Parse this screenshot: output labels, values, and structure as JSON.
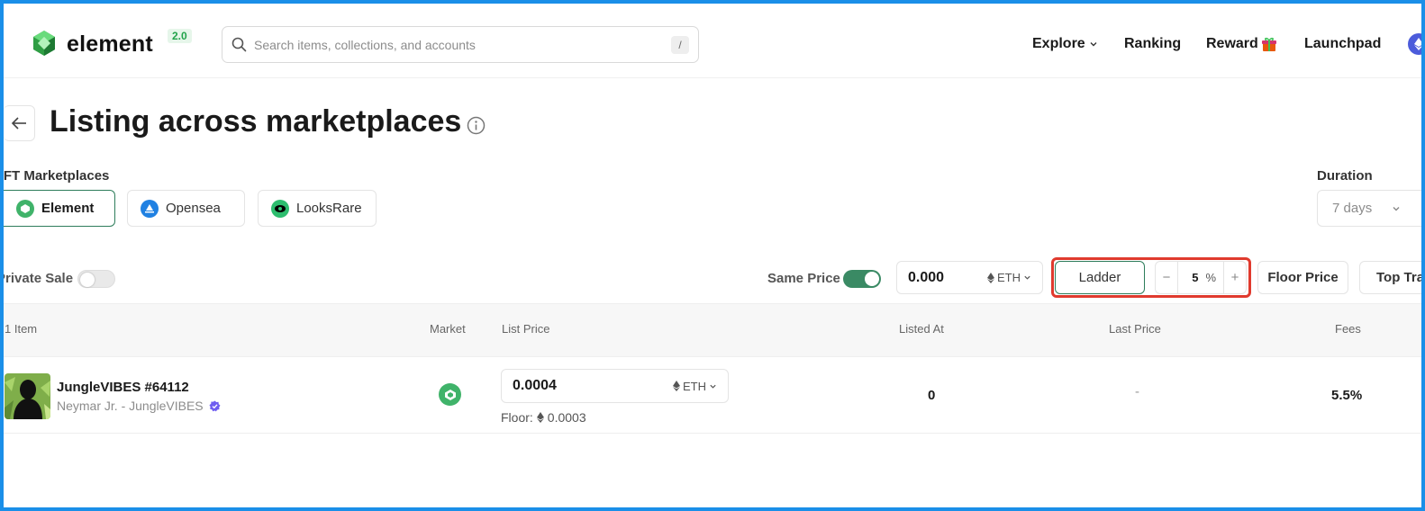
{
  "header": {
    "logo_text": "element",
    "version_badge": "2.0",
    "search_placeholder": "Search items, collections, and accounts",
    "search_shortcut": "/",
    "nav": [
      "Explore",
      "Ranking",
      "Reward",
      "Launchpad"
    ]
  },
  "page": {
    "title": "Listing across marketplaces",
    "marketplaces_label": "NFT Marketplaces",
    "marketplaces": [
      "Element",
      "Opensea",
      "LooksRare"
    ],
    "active_marketplace": "Element",
    "duration_label": "Duration",
    "duration_value": "7 days"
  },
  "controls": {
    "private_sale_label": "Private Sale",
    "private_sale_on": false,
    "same_price_label": "Same Price",
    "same_price_on": true,
    "price_value": "0.000",
    "currency": "ETH",
    "ladder_label": "Ladder",
    "step_minus": "−",
    "step_value": "5",
    "step_unit": "%",
    "step_plus": "+",
    "floor_price_label": "Floor Price",
    "top_trait_label": "Top Trait"
  },
  "table": {
    "columns": [
      "1 Item",
      "Market",
      "List Price",
      "Listed At",
      "Last Price",
      "Fees"
    ],
    "rows": [
      {
        "name": "JungleVIBES #64112",
        "collection": "Neymar Jr. - JungleVIBES",
        "list_price": "0.0004",
        "currency": "ETH",
        "floor_label": "Floor:",
        "floor_value": "0.0003",
        "listed_at": "0",
        "last_price": "-",
        "fees": "5.5%"
      }
    ]
  },
  "colors": {
    "accent_green": "#2e7d5b",
    "highlight_red": "#e03a2e",
    "frame_blue": "#1a8fe8"
  }
}
